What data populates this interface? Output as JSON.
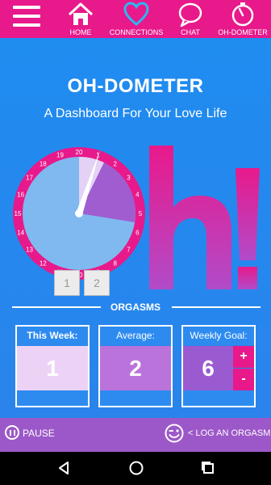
{
  "nav": {
    "items": [
      {
        "label": "HOME",
        "icon": "home-icon"
      },
      {
        "label": "CONNECTIONS",
        "icon": "heart-icon"
      },
      {
        "label": "CHAT",
        "icon": "chat-bubble-icon"
      },
      {
        "label": "OH-DOMETER",
        "icon": "stopwatch-icon"
      }
    ],
    "active": "OH-DOMETER"
  },
  "header": {
    "title": "OH-DOMETER",
    "subtitle": "A Dashboard For Your Love Life"
  },
  "gauge": {
    "dial_numbers": [
      "1",
      "2",
      "3",
      "4",
      "5",
      "6",
      "7",
      "8",
      "9",
      "10",
      "11",
      "12",
      "13",
      "14",
      "15",
      "16",
      "17",
      "18",
      "19",
      "20"
    ],
    "counter_digits": [
      "1",
      "2"
    ],
    "logo_text": "h!"
  },
  "orgasms": {
    "section_title": "ORGASMS",
    "this_week_label": "This Week:",
    "this_week_value": "1",
    "average_label": "Average:",
    "average_value": "2",
    "weekly_goal_label": "Weekly Goal:",
    "weekly_goal_value": "6",
    "plus_label": "+",
    "minus_label": "-"
  },
  "actions": {
    "pause_label": "PAUSE",
    "log_label": "< LOG AN ORGASM"
  },
  "colors": {
    "brand_pink": "#e8198b",
    "background_blue": "#1e90f0",
    "purple": "#9c58c8",
    "light_lavender": "#ecd3f5",
    "mid_lavender": "#bb73dc"
  }
}
